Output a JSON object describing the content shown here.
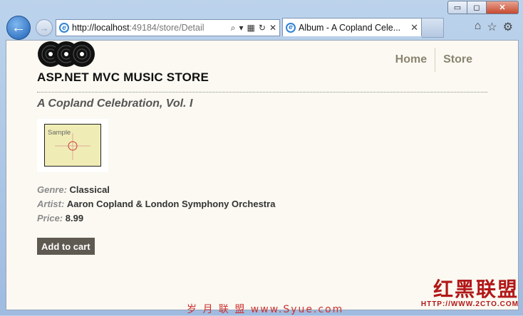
{
  "browser": {
    "window_controls": [
      "▭",
      "◻",
      "✕"
    ],
    "url_host": "http://localhost",
    "url_path": ":49184/store/Detail",
    "tab_title": "Album - A Copland Cele...",
    "tab_close": "✕"
  },
  "site": {
    "title": "ASP.NET MVC MUSIC STORE",
    "nav": [
      "Home",
      "Store"
    ]
  },
  "album": {
    "title": "A Copland Celebration, Vol. I",
    "art_label": "Sample",
    "genre_label": "Genre:",
    "genre": "Classical",
    "artist_label": "Artist:",
    "artist": "Aaron Copland & London Symphony Orchestra",
    "price_label": "Price:",
    "price": "8.99",
    "add_to_cart": "Add to cart"
  },
  "watermark": {
    "center": "岁 月 联 盟  www.Syue.com",
    "brand": "红黑联盟",
    "brand_url": "HTTP://WWW.2CTO.COM"
  },
  "colors": {
    "page_bg": "#fbf9f2",
    "nav_link": "#8a8470",
    "button_bg": "#5f5a51",
    "label": "#8b8b8b"
  }
}
